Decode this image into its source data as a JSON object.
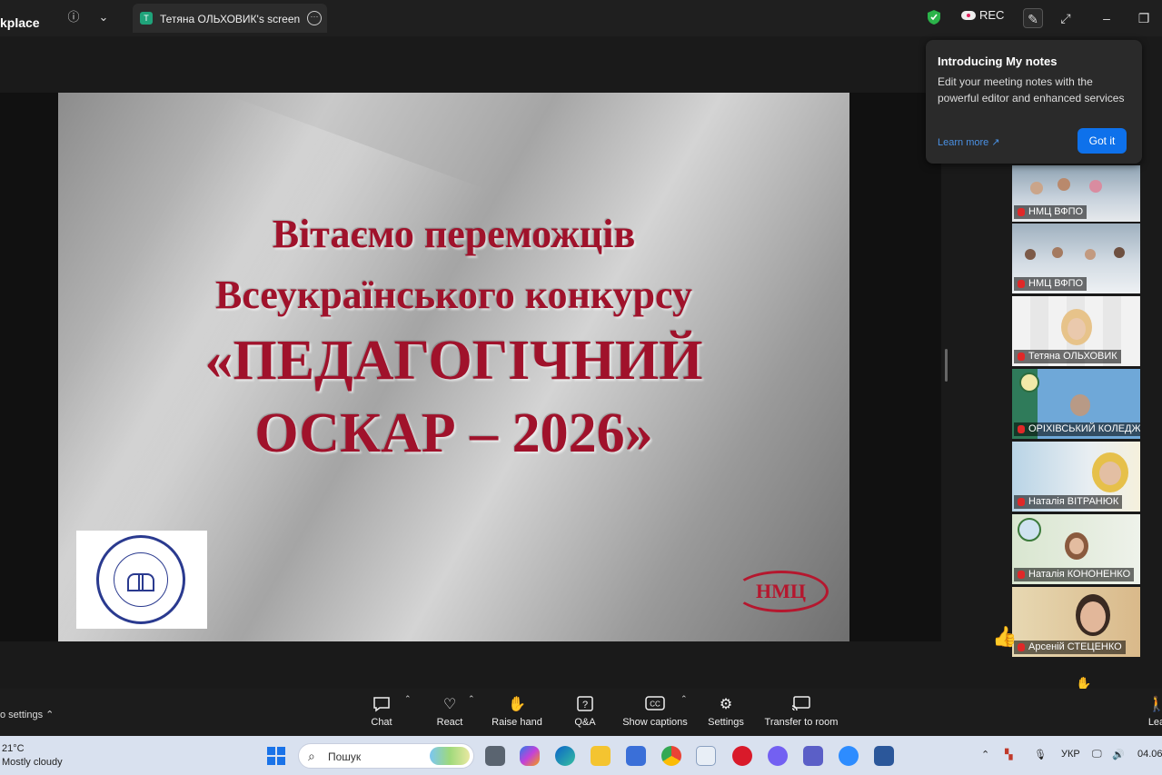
{
  "window": {
    "app_title": "kplace",
    "tab_label": "Тетяна ОЛЬХОВИК's screen",
    "tab_badge": "T",
    "rec_label": "REC"
  },
  "slide": {
    "line1": "Вітаємо переможців",
    "line2": "Всеукраїнського конкурсу",
    "line3": "«ПЕДАГОГІЧНИЙ",
    "line4": "ОСКАР – 2026»",
    "logo_right_text": "НМЦ"
  },
  "tooltip": {
    "title": "Introducing My notes",
    "body": "Edit your meeting notes with the powerful editor and enhanced services",
    "link": "Learn more ↗",
    "button": "Got it"
  },
  "participants": [
    {
      "name": "НМЦ ВФПО"
    },
    {
      "name": "НМЦ ВФПО"
    },
    {
      "name": "Тетяна ОЛЬХОВИК"
    },
    {
      "name": "ОРІХІВСЬКИЙ КОЛЕДЖ"
    },
    {
      "name": "Наталія ВІТРАНЮК"
    },
    {
      "name": "Наталія КОНОНЕНКО"
    },
    {
      "name": "Арсеній СТЕЦЕНКО"
    }
  ],
  "toolbar": {
    "audio_settings": "o settings",
    "chat": "Chat",
    "react": "React",
    "raise_hand": "Raise hand",
    "qa": "Q&A",
    "show_captions": "Show captions",
    "settings": "Settings",
    "transfer": "Transfer to room",
    "leave": "Lea"
  },
  "taskbar": {
    "temp": "21°C",
    "weather": "Mostly cloudy",
    "search_placeholder": "Пошук",
    "lang": "УКР",
    "date": "04.06"
  },
  "colors": {
    "slide_text": "#a0122b",
    "accent_blue": "#0e71eb",
    "taskbar": "#d9e1ef"
  }
}
